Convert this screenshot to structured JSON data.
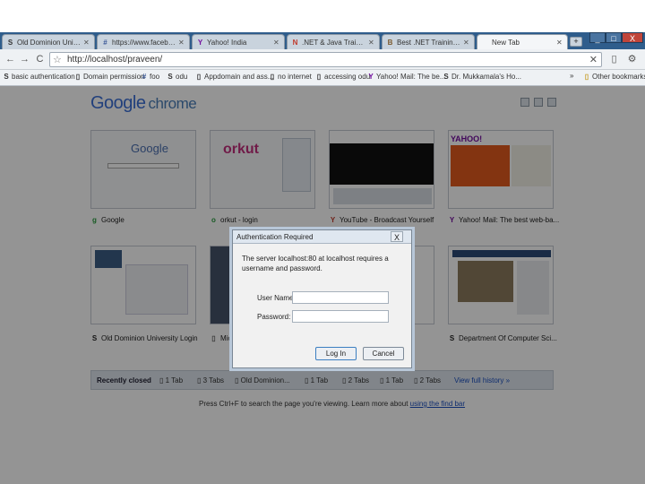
{
  "tabs": [
    {
      "label": "Old Dominion Univers...",
      "favicon": "S",
      "color": "#333333"
    },
    {
      "label": "https://www.facebook.c...",
      "favicon": "#",
      "color": "#3b5998"
    },
    {
      "label": "Yahoo! India",
      "favicon": "Y",
      "color": "#720e9e"
    },
    {
      "label": ".NET & Java Training ar...",
      "favicon": "N",
      "color": "#c0392b"
    },
    {
      "label": "Best .NET Training | Pun...",
      "favicon": "B",
      "color": "#7b5a2e"
    },
    {
      "label": "New Tab",
      "favicon": "",
      "color": "#333333",
      "active": true
    }
  ],
  "window": {
    "minimize": "_",
    "maximize": "□",
    "close": "X"
  },
  "toolbar": {
    "back": "←",
    "forward": "→",
    "reload": "C",
    "url": "http://localhost/praveen/",
    "star": "☆",
    "page_menu": "▯",
    "wrench": "⚙"
  },
  "bookmarks": [
    {
      "label": "basic authentication",
      "icon": "S"
    },
    {
      "label": "Domain permission",
      "icon": "▯"
    },
    {
      "label": "foo",
      "icon": "#"
    },
    {
      "label": "odu",
      "icon": "S"
    },
    {
      "label": "Appdomain and ass...",
      "icon": "▯"
    },
    {
      "label": "no internet",
      "icon": "▯"
    },
    {
      "label": "accessing odu",
      "icon": "▯"
    },
    {
      "label": "Yahoo! Mail: The be...",
      "icon": "Y"
    },
    {
      "label": "Dr. Mukkamala's Ho...",
      "icon": "S"
    },
    {
      "label": "Other bookmarks",
      "icon": "▯"
    }
  ],
  "logo": {
    "google": "Google",
    "chrome": "chrome"
  },
  "thumbnails": [
    {
      "label": "Google",
      "icon": "g",
      "icon_color": "#2a9d3e"
    },
    {
      "label": "orkut - login",
      "icon": "o",
      "icon_color": "#2a9d3e"
    },
    {
      "label": "YouTube - Broadcast Yourself",
      "icon": "Y",
      "icon_color": "#c0392b"
    },
    {
      "label": "Yahoo! Mail: The best web-ba...",
      "icon": "Y",
      "icon_color": "#720e9e"
    },
    {
      "label": "Old Dominion University Login",
      "icon": "S",
      "icon_color": "#333333"
    },
    {
      "label": "Mic...",
      "icon": "▯",
      "icon_color": "#666666"
    },
    {
      "label": "",
      "icon": "",
      "icon_color": "#666666"
    },
    {
      "label": "Department Of Computer Sci...",
      "icon": "S",
      "icon_color": "#333333"
    }
  ],
  "recently_closed": {
    "title": "Recently closed",
    "items": [
      "1 Tab",
      "3 Tabs",
      "Old Dominion...",
      "1 Tab",
      "2 Tabs",
      "1 Tab",
      "2 Tabs"
    ],
    "view_history": "View full history »"
  },
  "tip": {
    "text": "Press Ctrl+F to search the page you're viewing. Learn more about",
    "link": "using the find bar"
  },
  "dialog": {
    "title": "Authentication Required",
    "close": "X",
    "message": "The server localhost:80 at localhost requires a username and password.",
    "username_label": "User Name:",
    "username_value": "",
    "password_label": "Password:",
    "password_value": "",
    "login_label": "Log In",
    "cancel_label": "Cancel"
  }
}
